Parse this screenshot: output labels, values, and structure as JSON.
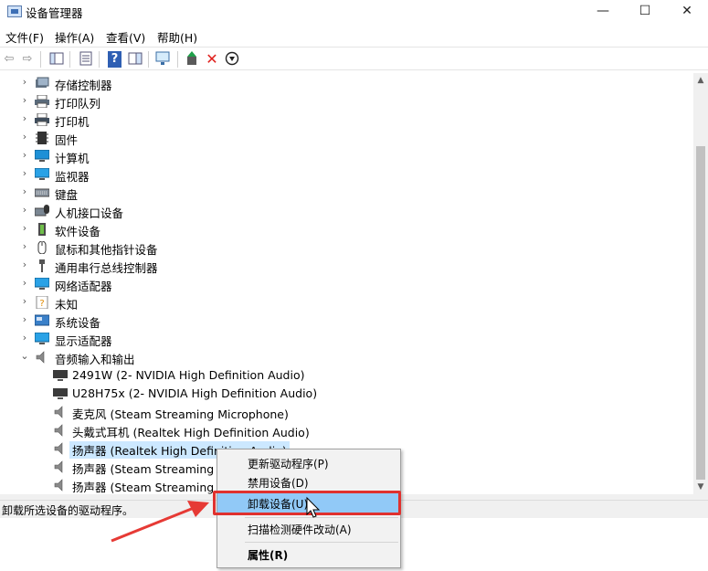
{
  "window": {
    "title": "设备管理器",
    "minimize": "—",
    "maximize": "☐",
    "close": "✕"
  },
  "menu": [
    "文件(F)",
    "操作(A)",
    "查看(V)",
    "帮助(H)"
  ],
  "toolbar": {
    "back": "⇦",
    "forward": "⇨",
    "help": "?",
    "disable": "✕",
    "download": "⬇"
  },
  "tree": {
    "categories": [
      {
        "label": "存储控制器",
        "icon": "storage-icon"
      },
      {
        "label": "打印队列",
        "icon": "print-queue-icon"
      },
      {
        "label": "打印机",
        "icon": "printer-icon"
      },
      {
        "label": "固件",
        "icon": "firmware-icon"
      },
      {
        "label": "计算机",
        "icon": "computer-icon"
      },
      {
        "label": "监视器",
        "icon": "monitor-icon"
      },
      {
        "label": "键盘",
        "icon": "keyboard-icon"
      },
      {
        "label": "人机接口设备",
        "icon": "hid-icon"
      },
      {
        "label": "软件设备",
        "icon": "software-device-icon"
      },
      {
        "label": "鼠标和其他指针设备",
        "icon": "mouse-icon"
      },
      {
        "label": "通用串行总线控制器",
        "icon": "usb-icon"
      },
      {
        "label": "网络适配器",
        "icon": "network-icon"
      },
      {
        "label": "未知",
        "icon": "unknown-icon"
      },
      {
        "label": "系统设备",
        "icon": "system-device-icon"
      },
      {
        "label": "显示适配器",
        "icon": "display-adapter-icon"
      }
    ],
    "expanded": {
      "label": "音频输入和输出",
      "icon": "speaker-icon"
    },
    "children": [
      {
        "label": "2491W (2- NVIDIA High Definition Audio)",
        "icon": "monitor-audio-icon"
      },
      {
        "label": "U28H75x (2- NVIDIA High Definition Audio)",
        "icon": "monitor-audio-icon"
      },
      {
        "label": "麦克风 (Steam Streaming Microphone)",
        "icon": "speaker-icon"
      },
      {
        "label": "头戴式耳机 (Realtek High Definition Audio)",
        "icon": "speaker-icon"
      },
      {
        "label": "扬声器 (Realtek High Definition Audio)",
        "icon": "speaker-icon",
        "selected": true
      },
      {
        "label": "扬声器 (Steam Streaming M",
        "icon": "speaker-icon"
      },
      {
        "label": "扬声器 (Steam Streaming Sp",
        "icon": "speaker-icon"
      }
    ]
  },
  "status": "卸载所选设备的驱动程序。",
  "context_menu": {
    "items": [
      {
        "label": "更新驱动程序(P)"
      },
      {
        "label": "禁用设备(D)"
      },
      {
        "label": "卸载设备(U)",
        "highlighted": true
      },
      {
        "label": "扫描检测硬件改动(A)"
      },
      {
        "label": "属性(R)",
        "bold": true
      }
    ]
  },
  "colors": {
    "highlight_box": "#e0312e",
    "menu_hover": "#91c9f7",
    "selection": "#cce8ff",
    "arrow": "#e63a35"
  }
}
